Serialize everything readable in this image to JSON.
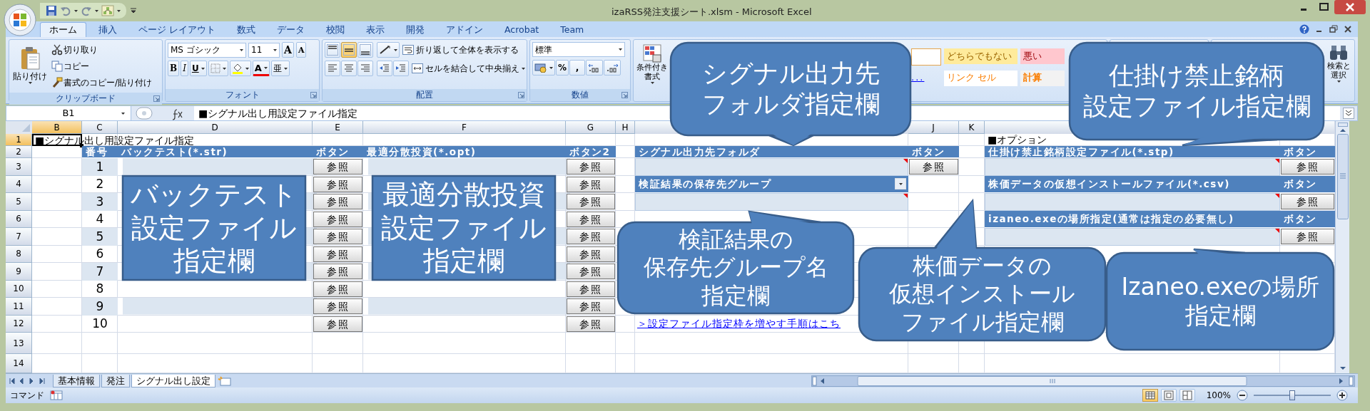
{
  "window": {
    "title": "izaRSS発注支援シート.xlsm - Microsoft Excel"
  },
  "ribbon_tabs": [
    {
      "label": "ホーム",
      "selected": true
    },
    {
      "label": "挿入",
      "selected": false
    },
    {
      "label": "ページ レイアウト",
      "selected": false
    },
    {
      "label": "数式",
      "selected": false
    },
    {
      "label": "データ",
      "selected": false
    },
    {
      "label": "校閲",
      "selected": false
    },
    {
      "label": "表示",
      "selected": false
    },
    {
      "label": "開発",
      "selected": false
    },
    {
      "label": "アドイン",
      "selected": false
    },
    {
      "label": "Acrobat",
      "selected": false
    },
    {
      "label": "Team",
      "selected": false
    }
  ],
  "clipboard": {
    "paste": "貼り付け",
    "cut": "切り取り",
    "copy": "コピー",
    "format_painter": "書式のコピー/貼り付け",
    "label": "クリップボード"
  },
  "font": {
    "name": "MS ゴシック",
    "size": "11",
    "grow": "A",
    "shrink": "A",
    "bold": "B",
    "italic": "I",
    "underline": "U",
    "font_color_button": "A",
    "phonetic": "亜",
    "label": "フォント"
  },
  "alignment": {
    "vertical_align": [
      {
        "selected": false
      },
      {
        "selected": true
      },
      {
        "selected": false
      }
    ],
    "wrap": "折り返して全体を表示する",
    "merge": "セルを結合して中央揃え",
    "label": "配置"
  },
  "number": {
    "format": "標準",
    "percent": "%",
    "comma": ",",
    "label": "数値"
  },
  "styles": {
    "conditional": [
      "条件付き",
      "書式"
    ],
    "link_hint": "...",
    "cells": [
      {
        "label": "どちらでもない",
        "kind": "neutral"
      },
      {
        "label": "悪い",
        "kind": "bad"
      },
      {
        "label": "リンク セル",
        "kind": "linked"
      },
      {
        "label": "計算",
        "kind": "calc"
      }
    ]
  },
  "editing": {
    "find_select": [
      "検索と",
      "選択"
    ]
  },
  "formula_bar": {
    "name_box": "B1",
    "formula": "■シグナル出し用設定ファイル指定"
  },
  "column_headers": [
    {
      "label": "B",
      "selected": true
    },
    {
      "label": "C",
      "selected": false
    },
    {
      "label": "D",
      "selected": false
    },
    {
      "label": "E",
      "selected": false
    },
    {
      "label": "F",
      "selected": false
    },
    {
      "label": "G",
      "selected": false
    },
    {
      "label": "H",
      "selected": false
    },
    {
      "selected": false
    },
    {
      "label": "J",
      "selected": false
    },
    {
      "label": "K",
      "selected": false
    },
    {
      "selected": false
    },
    {
      "selected": false
    }
  ],
  "row_headers": [
    {
      "label": "1",
      "selected": true
    },
    {
      "label": "2",
      "selected": false
    },
    {
      "label": "3",
      "selected": false
    },
    {
      "label": "4",
      "selected": false
    },
    {
      "label": "5",
      "selected": false
    },
    {
      "label": "6",
      "selected": false
    },
    {
      "label": "7",
      "selected": false
    },
    {
      "label": "8",
      "selected": false
    },
    {
      "label": "9",
      "selected": false
    },
    {
      "label": "10",
      "selected": false
    },
    {
      "label": "11",
      "selected": false
    },
    {
      "label": "12",
      "selected": false
    },
    {
      "label": "13",
      "selected": false
    },
    {
      "label": "14",
      "selected": false
    }
  ],
  "sheet_title": "■シグナル出し用設定ファイル指定",
  "backtest": {
    "headers": {
      "number": "番号",
      "backtest": "バックテスト(*.str)",
      "button": "ボタン",
      "optimal": "最適分散投資(*.opt)",
      "button2": "ボタン2"
    },
    "rows": [
      {
        "number": "1",
        "button": "参照",
        "button2": "参照"
      },
      {
        "number": "2",
        "button": "参照",
        "button2": "参照"
      },
      {
        "number": "3",
        "button": "参照",
        "button2": "参照"
      },
      {
        "number": "4",
        "button": "参照",
        "button2": "参照"
      },
      {
        "number": "5",
        "button": "参照",
        "button2": "参照"
      },
      {
        "number": "6",
        "button": "参照",
        "button2": "参照"
      },
      {
        "number": "7",
        "button": "参照",
        "button2": "参照"
      },
      {
        "number": "8",
        "button": "参照",
        "button2": "参照"
      },
      {
        "number": "9",
        "button": "参照",
        "button2": "参照"
      },
      {
        "number": "10",
        "button": "参照",
        "button2": "参照"
      }
    ]
  },
  "signal_folder": {
    "label": "シグナル出力先フォルダ",
    "button_header": "ボタン",
    "button": "参照"
  },
  "result_group": {
    "label": "検証結果の保存先グループ"
  },
  "options": {
    "title": "■オプション",
    "items": [
      {
        "label": "仕掛け禁止銘柄設定ファイル(*.stp)",
        "button_header": "ボタン",
        "button": "参照"
      },
      {
        "label": "株価データの仮想インストールファイル(*.csv)",
        "button_header": "ボタン",
        "button": "参照"
      },
      {
        "label": "izaneo.exeの場所指定(通常は指定の必要無し)",
        "button_header": "ボタン",
        "button": "参照"
      }
    ]
  },
  "help_link": "＞設定ファイル指定枠を増やす手順はこち",
  "callouts": [
    {
      "lines": [
        "シグナル出力先",
        "フォルダ指定欄"
      ],
      "kind": "speech"
    },
    {
      "lines": [
        "仕掛け禁止銘柄",
        "設定ファイル指定欄"
      ],
      "kind": "speech"
    },
    {
      "lines": [
        "バックテスト",
        "設定ファイル",
        "指定欄"
      ],
      "kind": "box"
    },
    {
      "lines": [
        "最適分散投資",
        "設定ファイル",
        "指定欄"
      ],
      "kind": "box"
    },
    {
      "lines": [
        "検証結果の",
        "保存先グループ名",
        "指定欄"
      ],
      "kind": "speech"
    },
    {
      "lines": [
        "株価データの",
        "仮想インストール",
        "ファイル指定欄"
      ],
      "kind": "speech"
    },
    {
      "lines": [
        "Izaneo.exeの場所",
        "指定欄"
      ],
      "kind": "speech"
    }
  ],
  "sheet_tabs": [
    {
      "label": "基本情報",
      "selected": false
    },
    {
      "label": "発注",
      "selected": false
    },
    {
      "label": "シグナル出し設定",
      "selected": true
    }
  ],
  "status_bar": {
    "mode": "コマンド",
    "views": [
      {
        "selected": true
      },
      {
        "selected": false
      },
      {
        "selected": false
      }
    ],
    "zoom": "100%",
    "zoom_slider": {
      "level": 0.5
    }
  }
}
